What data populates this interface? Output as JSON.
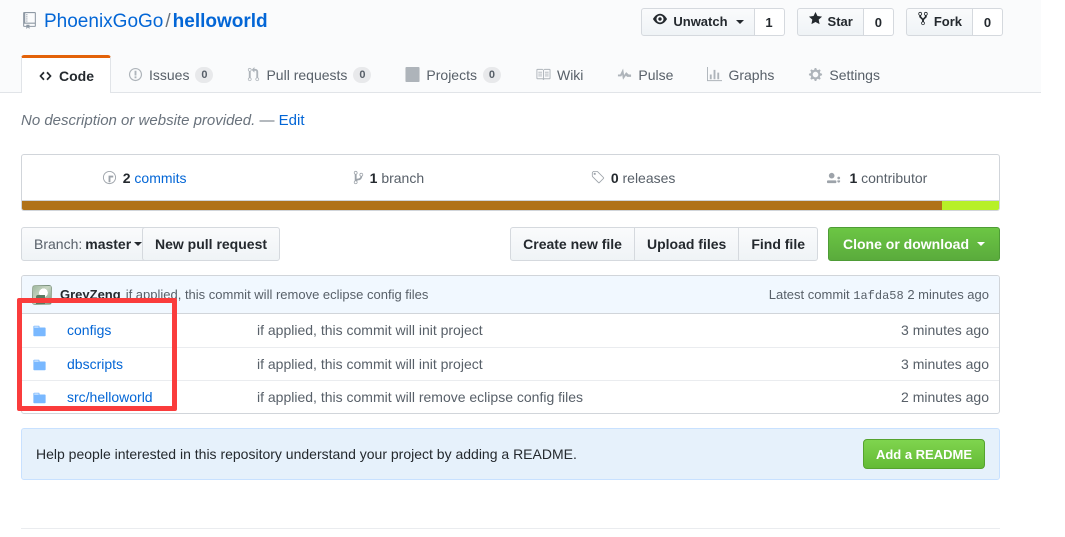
{
  "header": {
    "repo_icon": "repo-icon",
    "owner": "PhoenixGoGo",
    "separator": "/",
    "name": "helloworld",
    "actions": [
      {
        "icon": "eye-icon",
        "label": "Unwatch",
        "has_caret": true,
        "count": "1"
      },
      {
        "icon": "star-icon",
        "label": "Star",
        "has_caret": false,
        "count": "0"
      },
      {
        "icon": "fork-icon",
        "label": "Fork",
        "has_caret": false,
        "count": "0"
      }
    ]
  },
  "nav": {
    "items": [
      {
        "icon": "code-icon",
        "label": "Code",
        "count": null,
        "selected": true
      },
      {
        "icon": "issue-icon",
        "label": "Issues",
        "count": "0",
        "selected": false
      },
      {
        "icon": "pr-icon",
        "label": "Pull requests",
        "count": "0",
        "selected": false
      },
      {
        "icon": "project-icon",
        "label": "Projects",
        "count": "0",
        "selected": false
      },
      {
        "icon": "wiki-icon",
        "label": "Wiki",
        "count": null,
        "selected": false
      },
      {
        "icon": "pulse-icon",
        "label": "Pulse",
        "count": null,
        "selected": false
      },
      {
        "icon": "graph-icon",
        "label": "Graphs",
        "count": null,
        "selected": false
      },
      {
        "icon": "gear-icon",
        "label": "Settings",
        "count": null,
        "selected": false
      }
    ]
  },
  "description": {
    "text": "No description or website provided.",
    "dash": "—",
    "edit_label": "Edit"
  },
  "summary": {
    "items": [
      {
        "icon": "history-icon",
        "num": "2",
        "label": "commits",
        "link": true
      },
      {
        "icon": "branch-icon",
        "num": "1",
        "label": "branch",
        "link": false
      },
      {
        "icon": "tag-icon",
        "num": "0",
        "label": "releases",
        "link": false
      },
      {
        "icon": "people-icon",
        "num": "1",
        "label": "contributor",
        "link": false
      }
    ],
    "languages": [
      {
        "name": "brown-language",
        "color": "#b07219",
        "percent": 94.2
      },
      {
        "name": "green-language",
        "color": "#b7f028",
        "percent": 5.8
      }
    ]
  },
  "file_actions": {
    "branch_prefix": "Branch:",
    "branch_name": "master",
    "new_pull_request": "New pull request",
    "create_new_file": "Create new file",
    "upload_files": "Upload files",
    "find_file": "Find file",
    "clone_or_download": "Clone or download"
  },
  "latest_commit": {
    "avatar": "user-avatar",
    "author": "GreyZeng",
    "message": "if applied, this commit will remove eclipse config files",
    "meta_prefix": "Latest commit",
    "sha": "1afda58",
    "age": "2 minutes ago"
  },
  "files": [
    {
      "icon": "folder-icon",
      "name": "configs",
      "message": "if applied, this commit will init project",
      "age": "3 minutes ago"
    },
    {
      "icon": "folder-icon",
      "name": "dbscripts",
      "message": "if applied, this commit will init project",
      "age": "3 minutes ago"
    },
    {
      "icon": "folder-icon",
      "name": "src/helloworld",
      "message": "if applied, this commit will remove eclipse config files",
      "age": "2 minutes ago"
    }
  ],
  "readme_prompt": {
    "text": "Help people interested in this repository understand your project by adding a README.",
    "button_label": "Add a README"
  },
  "annotation": {
    "name": "red-highlight-box",
    "color": "#fa3c3c"
  }
}
